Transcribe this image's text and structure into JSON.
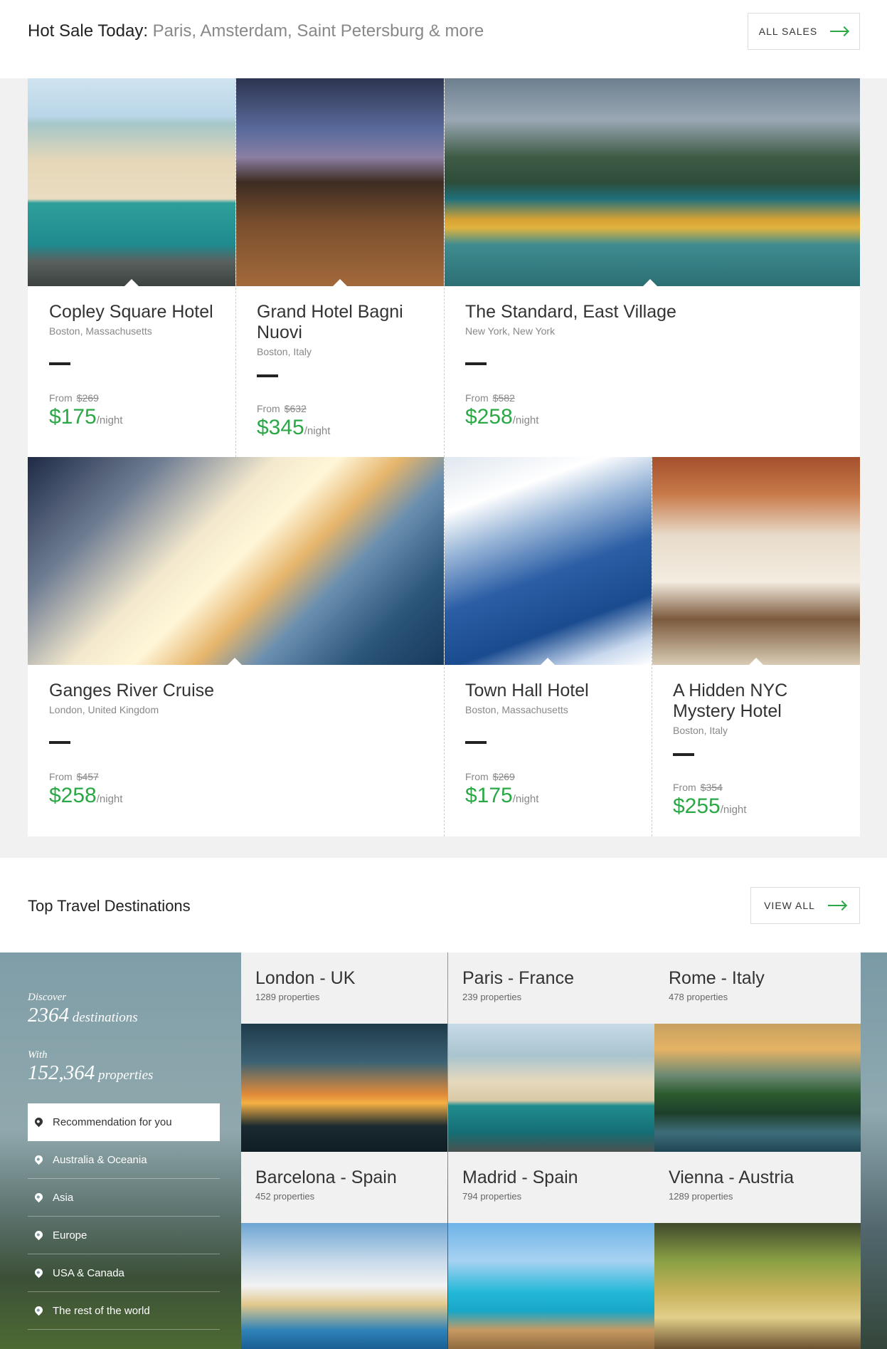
{
  "hot_sale": {
    "title": "Hot Sale Today:",
    "cities": "Paris, Amsterdam, Saint Petersburg & more",
    "button": "ALL SALES"
  },
  "hotels": [
    {
      "name": "Copley Square Hotel",
      "location": "Boston, Massachusetts",
      "from": "From",
      "old_price": "$269",
      "price": "$175",
      "unit": "/night"
    },
    {
      "name": "Grand Hotel Bagni Nuovi",
      "location": "Boston, Italy",
      "from": "From",
      "old_price": "$632",
      "price": "$345",
      "unit": "/night"
    },
    {
      "name": "The Standard, East Village",
      "location": "New York, New York",
      "from": "From",
      "old_price": "$582",
      "price": "$258",
      "unit": "/night"
    },
    {
      "name": "Ganges River Cruise",
      "location": "London, United Kingdom",
      "from": "From",
      "old_price": "$457",
      "price": "$258",
      "unit": "/night"
    },
    {
      "name": "Town Hall Hotel",
      "location": "Boston, Massachusetts",
      "from": "From",
      "old_price": "$269",
      "price": "$175",
      "unit": "/night"
    },
    {
      "name": "A Hidden NYC Mystery Hotel",
      "location": "Boston, Italy",
      "from": "From",
      "old_price": "$354",
      "price": "$255",
      "unit": "/night"
    }
  ],
  "destinations": {
    "title": "Top Travel Destinations",
    "button": "VIEW ALL",
    "sidebar": {
      "discover_label": "Discover",
      "destinations_count": "2364",
      "destinations_word": "destinations",
      "with_label": "With",
      "properties_count": "152,364",
      "properties_word": "properties",
      "menu": [
        "Recommendation for you",
        "Australia & Oceania",
        "Asia",
        "Europe",
        "USA & Canada",
        "The rest of the world"
      ]
    },
    "tiles": [
      {
        "name": "London - UK",
        "count": "1289",
        "suffix": "properties"
      },
      {
        "name": "Paris - France",
        "count": "239",
        "suffix": "properties"
      },
      {
        "name": "Rome - Italy",
        "count": "478",
        "suffix": "properties"
      },
      {
        "name": "Barcelona - Spain",
        "count": "452",
        "suffix": "properties"
      },
      {
        "name": "Madrid - Spain",
        "count": "794",
        "suffix": "properties"
      },
      {
        "name": "Vienna - Austria",
        "count": "1289",
        "suffix": "properties"
      }
    ]
  },
  "colors": {
    "accent_green": "#2aa845",
    "background": "#f1f1f1"
  },
  "icons": [
    "arrow-right-icon",
    "map-pin-icon"
  ]
}
